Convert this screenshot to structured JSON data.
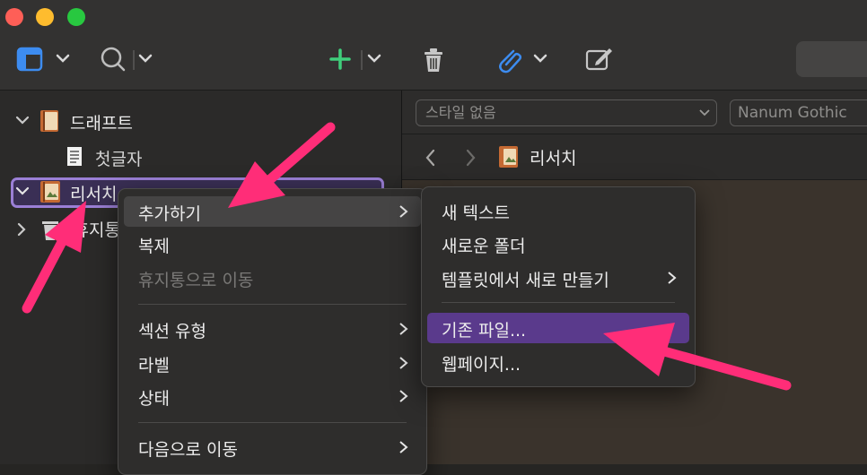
{
  "sidebar": {
    "items": [
      {
        "label": "드래프트"
      },
      {
        "label": "첫글자"
      },
      {
        "label": "리서치"
      },
      {
        "label": "휴지통"
      }
    ]
  },
  "format_bar": {
    "style_value": "스타일 없음",
    "font_value": "Nanum Gothic"
  },
  "nav_bar": {
    "current_title": "리서치"
  },
  "context_menu": {
    "items": [
      {
        "label": "추가하기"
      },
      {
        "label": "복제"
      },
      {
        "label": "휴지통으로 이동"
      },
      {
        "label": "섹션 유형"
      },
      {
        "label": "라벨"
      },
      {
        "label": "상태"
      },
      {
        "label": "다음으로 이동"
      }
    ]
  },
  "submenu": {
    "items": [
      {
        "label": "새 텍스트"
      },
      {
        "label": "새로운 폴더"
      },
      {
        "label": "템플릿에서 새로 만들기"
      },
      {
        "label": "기존 파일..."
      },
      {
        "label": "웹페이지..."
      }
    ]
  },
  "colors": {
    "selection_outline": "#9b7fd6",
    "highlight_purple": "#5a3a8c",
    "annotation_pink": "#ff2d78",
    "add_button_green": "#3fce7b",
    "attachment_blue": "#3d8cf0"
  }
}
